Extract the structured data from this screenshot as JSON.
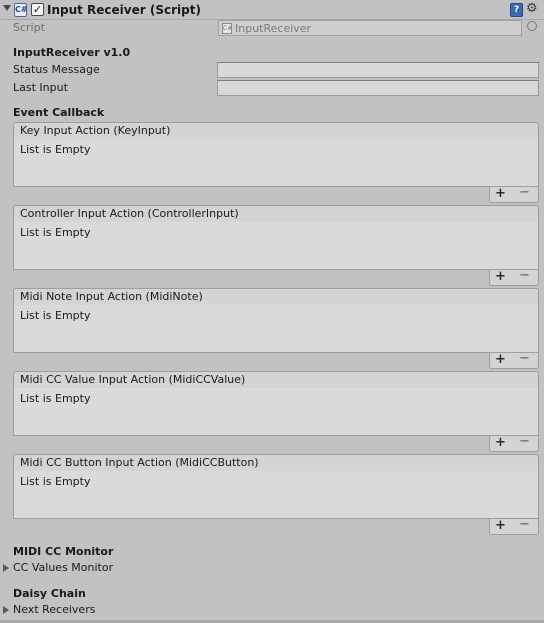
{
  "component": {
    "title": "Input Receiver (Script)",
    "icon": "script-icon",
    "enabled": true,
    "script_label": "Script",
    "script_value": "InputReceiver"
  },
  "section_receiver": {
    "heading": "InputReceiver v1.0",
    "status_label": "Status Message",
    "status_value": "",
    "last_input_label": "Last Input",
    "last_input_value": ""
  },
  "event_callback": {
    "heading": "Event Callback",
    "lists": [
      {
        "title": "Key Input Action (KeyInput)",
        "empty": "List is Empty"
      },
      {
        "title": "Controller Input Action (ControllerInput)",
        "empty": "List is Empty"
      },
      {
        "title": "Midi Note Input Action (MidiNote)",
        "empty": "List is Empty"
      },
      {
        "title": "Midi CC Value Input Action (MidiCCValue)",
        "empty": "List is Empty"
      },
      {
        "title": "Midi CC Button Input Action (MidiCCButton)",
        "empty": "List is Empty"
      }
    ],
    "add_label": "+",
    "remove_label": "−"
  },
  "midi_monitor": {
    "heading": "MIDI CC Monitor",
    "foldout": "CC Values Monitor"
  },
  "daisy_chain": {
    "heading": "Daisy Chain",
    "foldout": "Next Receivers"
  }
}
